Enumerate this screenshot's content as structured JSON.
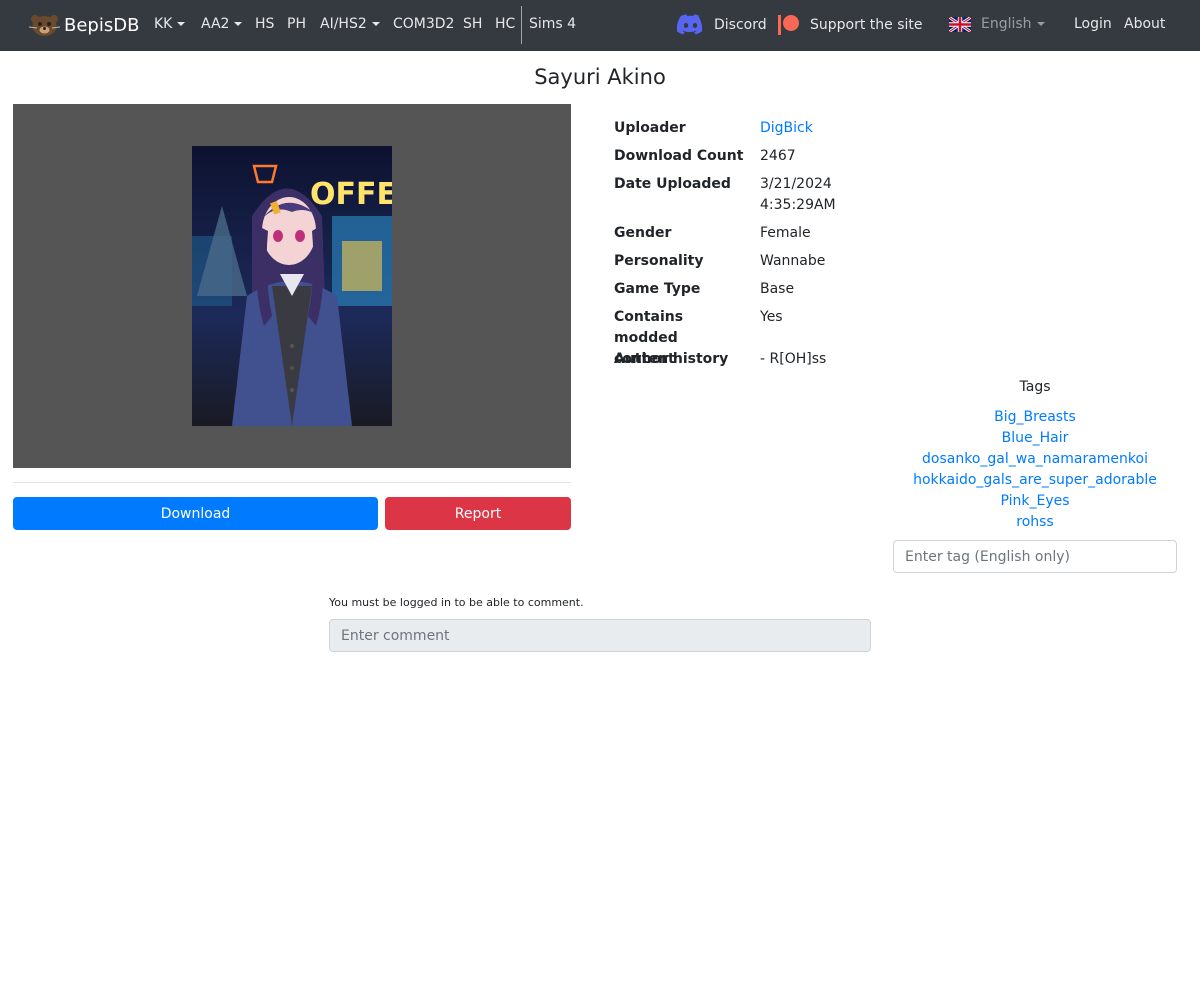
{
  "navbar": {
    "brand": "BepisDB",
    "items": [
      {
        "label": "KK",
        "dropdown": true
      },
      {
        "label": "AA2",
        "dropdown": true
      },
      {
        "label": "HS",
        "dropdown": false
      },
      {
        "label": "PH",
        "dropdown": false
      },
      {
        "label": "AI/HS2",
        "dropdown": true
      },
      {
        "label": "COM3D2",
        "dropdown": false
      },
      {
        "label": "SH",
        "dropdown": false
      },
      {
        "label": "HC",
        "dropdown": false
      },
      {
        "label": "Sims 4",
        "dropdown": false
      }
    ],
    "discord": "Discord",
    "support": "Support the site",
    "language": "English",
    "login": "Login",
    "about": "About"
  },
  "card": {
    "title": "Sayuri Akino",
    "image_sign_text": "OFFEE"
  },
  "actions": {
    "download": "Download",
    "report": "Report"
  },
  "info": [
    {
      "label": "Uploader",
      "value": "DigBick",
      "is_link": true
    },
    {
      "label": "Download Count",
      "value": "2467"
    },
    {
      "label": "Date Uploaded",
      "value": "3/21/2024 4:35:29AM"
    },
    {
      "label": "Gender",
      "value": "Female"
    },
    {
      "label": "Personality",
      "value": "Wannabe"
    },
    {
      "label": "Game Type",
      "value": "Base"
    },
    {
      "label": "Contains modded content",
      "value": "Yes"
    },
    {
      "label": "Author history",
      "value": "- R[OH]ss"
    }
  ],
  "tags": {
    "heading": "Tags",
    "items": [
      "Big_Breasts",
      "Blue_Hair",
      "dosanko_gal_wa_namaramenkoi",
      "hokkaido_gals_are_super_adorable",
      "Pink_Eyes",
      "rohss"
    ],
    "input_placeholder": "Enter tag (English only)"
  },
  "comments": {
    "notice": "You must be logged in to be able to comment.",
    "input_placeholder": "Enter comment"
  },
  "colors": {
    "navbar": "#343a40",
    "primary": "#007bff",
    "danger": "#dc3545",
    "preview_bg": "#555555"
  }
}
